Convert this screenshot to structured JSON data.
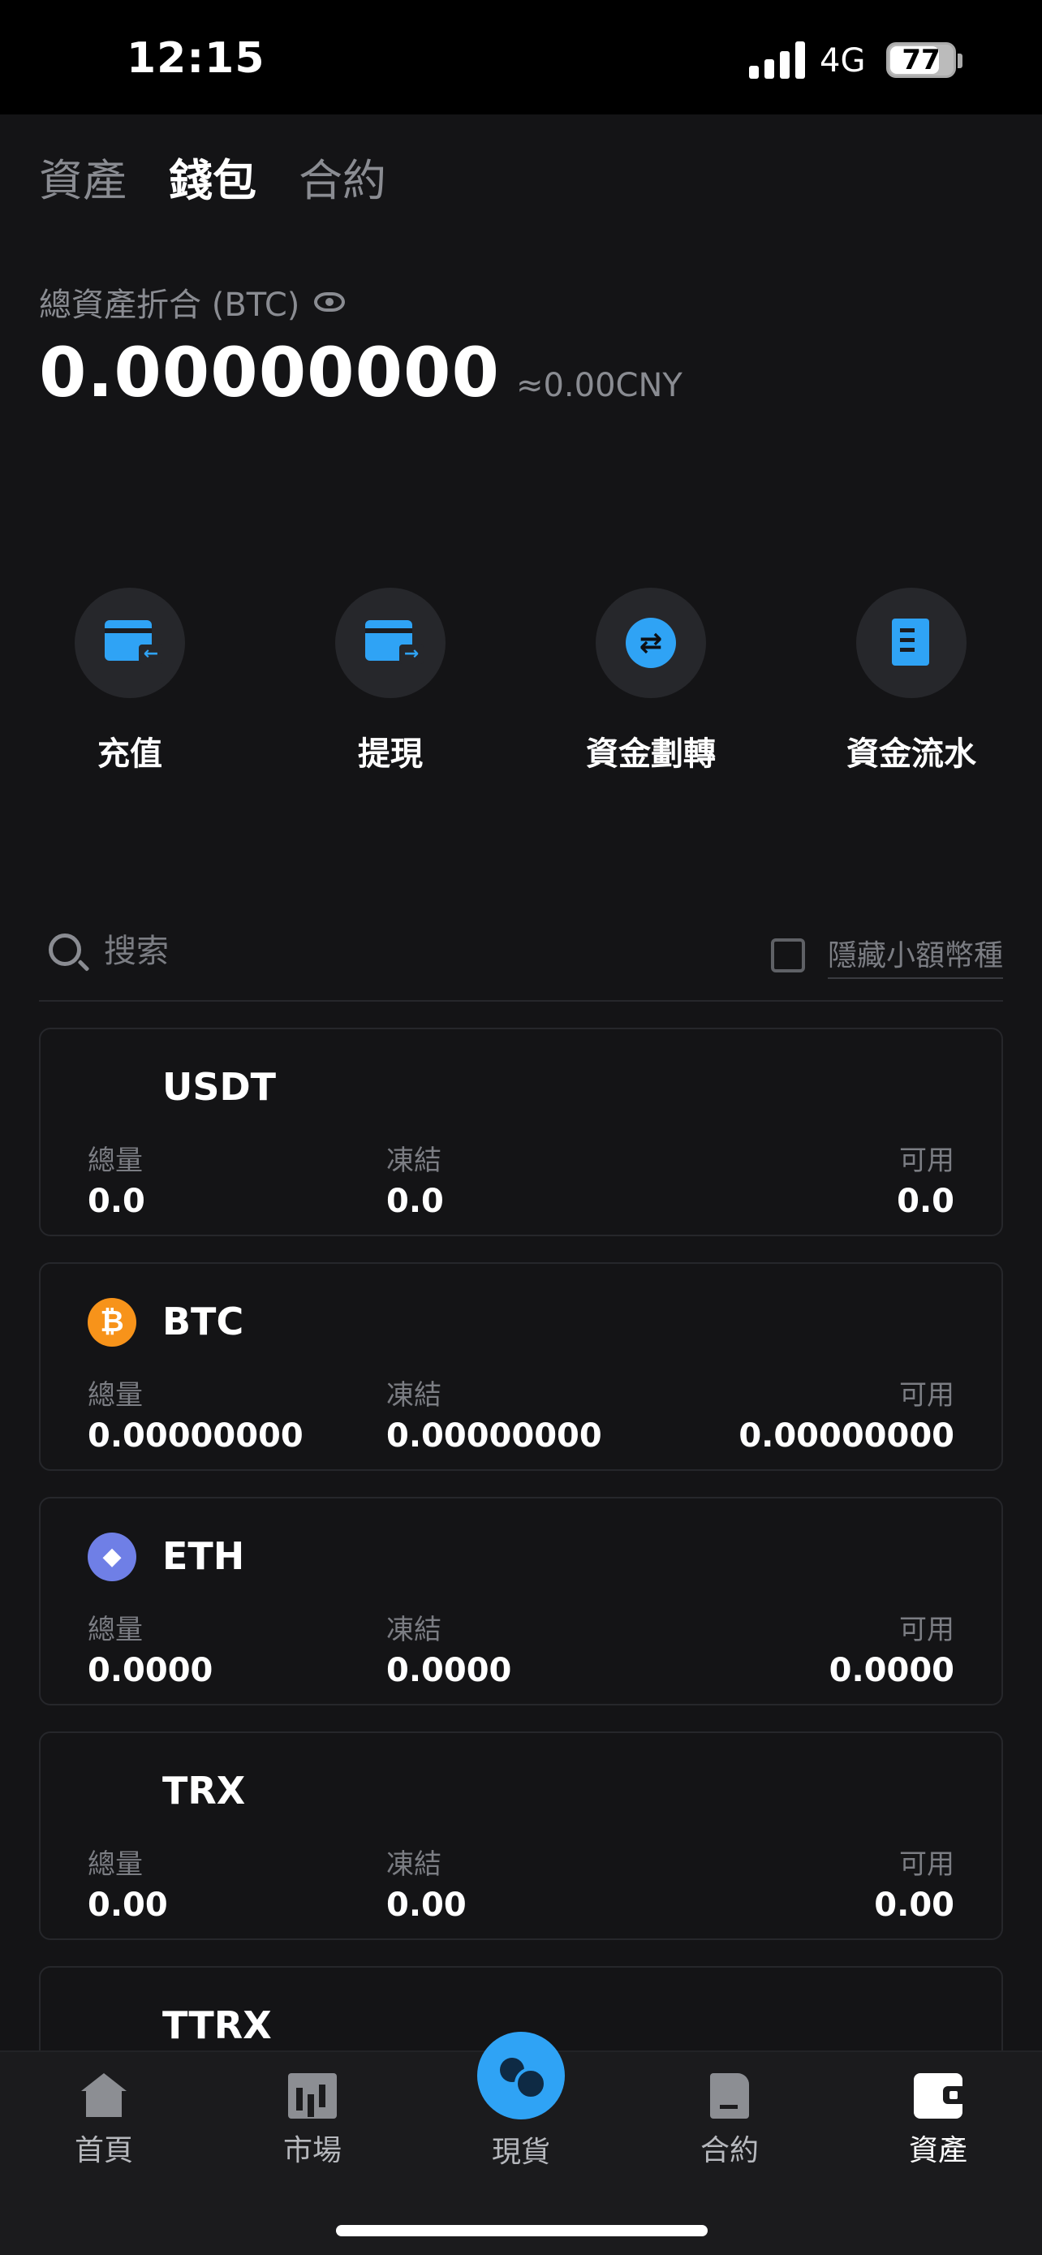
{
  "status_bar": {
    "time": "12:15",
    "network": "4G",
    "battery": "77",
    "battery_fraction": 0.77
  },
  "top_tabs": [
    {
      "label": "資產",
      "active": false
    },
    {
      "label": "錢包",
      "active": true
    },
    {
      "label": "合約",
      "active": false
    }
  ],
  "summary": {
    "label": "總資產折合 (BTC)",
    "value": "0.00000000",
    "cny": "≈0.00CNY",
    "icon": "eye-icon"
  },
  "actions": [
    {
      "label": "充值",
      "icon": "deposit-icon"
    },
    {
      "label": "提現",
      "icon": "withdraw-icon"
    },
    {
      "label": "資金劃轉",
      "icon": "transfer-icon"
    },
    {
      "label": "資金流水",
      "icon": "ledger-icon"
    }
  ],
  "search": {
    "placeholder": "搜索",
    "hide_small_label": "隱藏小額幣種"
  },
  "column_labels": {
    "total": "總量",
    "frozen": "凍結",
    "available": "可用"
  },
  "assets": [
    {
      "name": "USDT",
      "total": "0.0",
      "frozen": "0.0",
      "available": "0.0",
      "logo": ""
    },
    {
      "name": "BTC",
      "total": "0.00000000",
      "frozen": "0.00000000",
      "available": "0.00000000",
      "logo": "btc-icon",
      "logo_color": "#f7931a",
      "logo_glyph": "₿"
    },
    {
      "name": "ETH",
      "total": "0.0000",
      "frozen": "0.0000",
      "available": "0.0000",
      "logo": "eth-icon",
      "logo_color": "#6f7fe6",
      "logo_glyph": "◆"
    },
    {
      "name": "TRX",
      "total": "0.00",
      "frozen": "0.00",
      "available": "0.00",
      "logo": ""
    },
    {
      "name": "TTRX",
      "total": "",
      "frozen": "",
      "available": "",
      "logo": ""
    }
  ],
  "bottom_nav": [
    {
      "label": "首頁",
      "icon": "home-icon"
    },
    {
      "label": "市場",
      "icon": "market-icon"
    },
    {
      "label": "現貨",
      "icon": "spot-icon"
    },
    {
      "label": "合約",
      "icon": "contract-icon"
    },
    {
      "label": "資產",
      "icon": "wallet-icon",
      "active": true
    }
  ],
  "colors": {
    "accent": "#2fa3f5",
    "background": "#141416",
    "muted_text": "#8a8c92"
  }
}
